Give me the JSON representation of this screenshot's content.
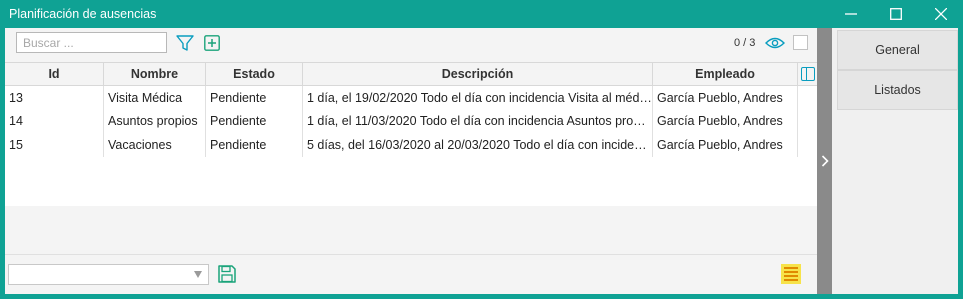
{
  "window": {
    "title": "Planificación de ausencias"
  },
  "toolbar": {
    "search_placeholder": "Buscar ...",
    "counter": "0 / 3"
  },
  "table": {
    "columns": [
      "Id",
      "Nombre",
      "Estado",
      "Descripción",
      "Empleado"
    ],
    "rows": [
      [
        "13",
        "Visita Médica",
        "Pendiente",
        "1 día, el 19/02/2020 Todo el día con incidencia Visita al médico",
        "García Pueblo, Andres"
      ],
      [
        "14",
        "Asuntos propios",
        "Pendiente",
        "1 día, el 11/03/2020 Todo el día con incidencia Asuntos propios",
        "García Pueblo, Andres"
      ],
      [
        "15",
        "Vacaciones",
        "Pendiente",
        "5 días, del 16/03/2020 al 20/03/2020 Todo el día con incidencia Vacaciones",
        "García Pueblo, Andres"
      ]
    ]
  },
  "side_panel": {
    "general_label": "General",
    "listados_label": "Listados"
  },
  "colors": {
    "accent": "#0fa294",
    "icon_teal": "#0a9dbf",
    "strip_gray": "#8a8a8a"
  },
  "icons": {
    "window": [
      "minimize-icon",
      "maximize-icon",
      "close-icon"
    ],
    "toolbar": [
      "filter-icon",
      "add-icon",
      "eye-icon"
    ],
    "bottom": [
      "save-icon",
      "notes-icon"
    ],
    "strip": "chevron-right-icon"
  }
}
